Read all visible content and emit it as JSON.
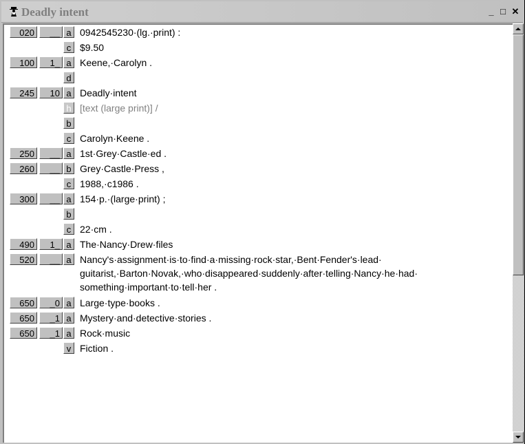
{
  "window": {
    "title": "Deadly intent",
    "controls": {
      "minimize": "_",
      "maximize": "□",
      "close": "✕"
    },
    "app_icon": "cowboy-figure-icon"
  },
  "record": [
    {
      "tag": "020",
      "ind": "__",
      "subfields": [
        {
          "code": "a",
          "text": "0942545230·(lg.·print)  :"
        },
        {
          "code": "c",
          "text": "$9.50"
        }
      ]
    },
    {
      "tag": "100",
      "ind": "1_",
      "subfields": [
        {
          "code": "a",
          "text": "Keene,·Carolyn ."
        },
        {
          "code": "d",
          "text": ""
        }
      ]
    },
    {
      "tag": "245",
      "ind": "10",
      "subfields": [
        {
          "code": "a",
          "text": "Deadly·intent"
        },
        {
          "code": "h",
          "text": "[text (large print)]  /",
          "dim": true
        },
        {
          "code": "b",
          "text": ""
        },
        {
          "code": "c",
          "text": "Carolyn·Keene ."
        }
      ]
    },
    {
      "tag": "250",
      "ind": "__",
      "subfields": [
        {
          "code": "a",
          "text": "1st·Grey·Castle·ed ."
        }
      ]
    },
    {
      "tag": "260",
      "ind": "__",
      "subfields": [
        {
          "code": "b",
          "text": "Grey·Castle·Press ,"
        },
        {
          "code": "c",
          "text": "1988,·c1986 ."
        }
      ]
    },
    {
      "tag": "300",
      "ind": "__",
      "subfields": [
        {
          "code": "a",
          "text": "154·p.·(large·print)  ;"
        },
        {
          "code": "b",
          "text": ""
        },
        {
          "code": "c",
          "text": "22·cm ."
        }
      ]
    },
    {
      "tag": "490",
      "ind": "1_",
      "subfields": [
        {
          "code": "a",
          "text": "The·Nancy·Drew·files"
        }
      ]
    },
    {
      "tag": "520",
      "ind": "__",
      "subfields": [
        {
          "code": "a",
          "lines": [
            "Nancy's·assignment·is·to·find·a·missing·rock·star,·Bent·Fender's·lead·",
            "guitarist,·Barton·Novak,·who·disappeared·suddenly·after·telling·Nancy·he·had·",
            "something·important·to·tell·her ."
          ]
        }
      ]
    },
    {
      "tag": "650",
      "ind": "_0",
      "subfields": [
        {
          "code": "a",
          "text": "Large·type·books ."
        }
      ]
    },
    {
      "tag": "650",
      "ind": "_1",
      "subfields": [
        {
          "code": "a",
          "text": "Mystery·and·detective·stories ."
        }
      ]
    },
    {
      "tag": "650",
      "ind": "_1",
      "subfields": [
        {
          "code": "a",
          "text": "Rock·music"
        },
        {
          "code": "v",
          "text": "Fiction ."
        }
      ]
    }
  ]
}
